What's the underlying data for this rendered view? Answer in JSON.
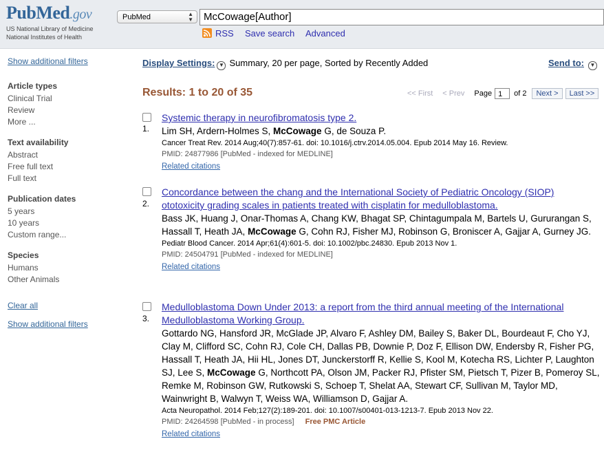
{
  "header": {
    "logo_main": "PubMed",
    "logo_gov": ".gov",
    "logo_sub1": "US National Library of Medicine",
    "logo_sub2": "National Institutes of Health",
    "database": "PubMed",
    "search_value": "McCowage[Author]",
    "links": {
      "rss": "RSS",
      "save_search": "Save search",
      "advanced": "Advanced"
    }
  },
  "sidebar": {
    "show_filters_top": "Show additional filters",
    "groups": [
      {
        "title": "Article types",
        "items": [
          "Clinical Trial",
          "Review",
          "More ..."
        ]
      },
      {
        "title": "Text availability",
        "items": [
          "Abstract",
          "Free full text",
          "Full text"
        ]
      },
      {
        "title": "Publication dates",
        "items": [
          "5 years",
          "10 years",
          "Custom range..."
        ]
      },
      {
        "title": "Species",
        "items": [
          "Humans",
          "Other Animals"
        ]
      }
    ],
    "clear_all": "Clear all",
    "show_filters_bottom": "Show additional filters"
  },
  "display": {
    "label": "Display Settings:",
    "summary": "Summary, 20 per page, Sorted by Recently Added",
    "send_to": "Send to:"
  },
  "results": {
    "title": "Results: 1 to 20 of 35",
    "pager": {
      "first": "<< First",
      "prev": "< Prev",
      "page_label": "Page",
      "page_value": "1",
      "of": "of 2",
      "next": "Next >",
      "last": "Last >>"
    },
    "items": [
      {
        "num": "1.",
        "title_lines": [
          "Systemic therapy in neurofibromatosis type 2."
        ],
        "authors_pre": "Lim SH, Ardern-Holmes S, ",
        "authors_bold": "McCowage",
        "authors_post": " G, de Souza P.",
        "journal": "Cancer Treat Rev. 2014 Aug;40(7):857-61. doi: 10.1016/j.ctrv.2014.05.004. Epub 2014 May 16. Review.",
        "pmid": "PMID: 24877986 [PubMed - indexed for MEDLINE]",
        "free": "",
        "related": "Related citations"
      },
      {
        "num": "2.",
        "title_lines": [
          "Concordance between the chang and the International Society of Pediatric Oncology (SIOP)",
          "ototoxicity grading scales in patients treated with cisplatin for medulloblastoma."
        ],
        "authors_pre": "Bass JK, Huang J, Onar-Thomas A, Chang KW, Bhagat SP, Chintagumpala M, Bartels U, Gururangan S, Hassall T, Heath JA, ",
        "authors_bold": "McCowage",
        "authors_post": " G, Cohn RJ, Fisher MJ, Robinson G, Broniscer A, Gajjar A, Gurney JG.",
        "journal": "Pediatr Blood Cancer. 2014 Apr;61(4):601-5. doi: 10.1002/pbc.24830. Epub 2013 Nov 1.",
        "pmid": "PMID: 24504791 [PubMed - indexed for MEDLINE]",
        "free": "",
        "related": "Related citations"
      },
      {
        "num": "3.",
        "title_lines": [
          "Medulloblastoma Down Under 2013: a report from the third annual meeting of the International",
          "Medulloblastoma Working Group."
        ],
        "authors_pre": "Gottardo NG, Hansford JR, McGlade JP, Alvaro F, Ashley DM, Bailey S, Baker DL, Bourdeaut F, Cho YJ, Clay M, Clifford SC, Cohn RJ, Cole CH, Dallas PB, Downie P, Doz F, Ellison DW, Endersby R, Fisher PG, Hassall T, Heath JA, Hii HL, Jones DT, Junckerstorff R, Kellie S, Kool M, Kotecha RS, Lichter P, Laughton SJ, Lee S, ",
        "authors_bold": "McCowage",
        "authors_post": " G, Northcott PA, Olson JM, Packer RJ, Pfister SM, Pietsch T, Pizer B, Pomeroy SL, Remke M, Robinson GW, Rutkowski S, Schoep T, Shelat AA, Stewart CF, Sullivan M, Taylor MD, Wainwright B, Walwyn T, Weiss WA, Williamson D, Gajjar A.",
        "journal": "Acta Neuropathol. 2014 Feb;127(2):189-201. doi: 10.1007/s00401-013-1213-7. Epub 2013 Nov 22.",
        "pmid": "PMID: 24264598 [PubMed - in process]",
        "free": "Free PMC Article",
        "related": "Related citations"
      }
    ]
  }
}
